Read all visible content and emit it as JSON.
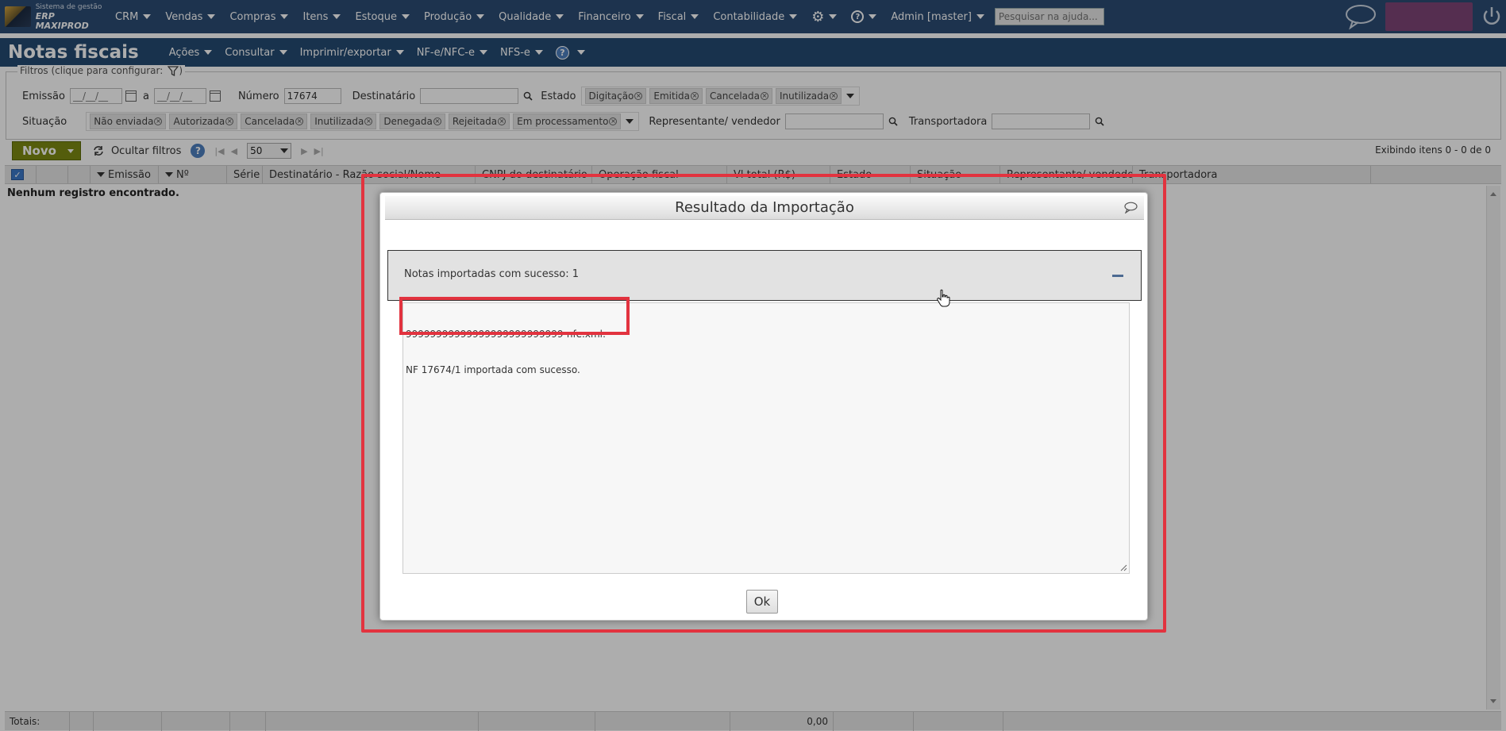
{
  "app": {
    "logo_small": "Sistema de gestão",
    "logo_big": "ERP MAXIPROD"
  },
  "topnav": {
    "items": [
      "CRM",
      "Vendas",
      "Compras",
      "Itens",
      "Estoque",
      "Produção",
      "Qualidade",
      "Financeiro",
      "Fiscal",
      "Contabilidade"
    ],
    "user": "Admin [master]",
    "search_placeholder": "Pesquisar na ajuda..."
  },
  "header": {
    "title": "Notas fiscais",
    "menu": [
      "Ações",
      "Consultar",
      "Imprimir/exportar",
      "NF-e/NFC-e",
      "NFS-e"
    ]
  },
  "filters": {
    "legend": "Filtros (clique para configurar:",
    "legend_close": ")",
    "emissao_label": "Emissão",
    "date_placeholder": "__/__/__",
    "a_label": "a",
    "numero_label": "Número",
    "numero_value": "17674",
    "destinatario_label": "Destinatário",
    "estado_label": "Estado",
    "estado_tags": [
      "Digitação",
      "Emitida",
      "Cancelada",
      "Inutilizada"
    ],
    "situacao_label": "Situação",
    "situacao_tags": [
      "Não enviada",
      "Autorizada",
      "Cancelada",
      "Inutilizada",
      "Denegada",
      "Rejeitada",
      "Em processamento"
    ],
    "representante_label": "Representante/ vendedor",
    "transportadora_label": "Transportadora"
  },
  "toolbar": {
    "novo_label": "Novo",
    "hide_filters": "Ocultar filtros",
    "page_size": "50",
    "count_text": "Exibindo itens 0 - 0 de 0"
  },
  "grid": {
    "columns": [
      "",
      "",
      "Emissão",
      "Nº",
      "Série",
      "Destinatário - Razão social/Nome",
      "CNPJ do destinatário",
      "Operação fiscal",
      "Vl total (R$)",
      "Estado",
      "Situação",
      "Representante/ vendedor",
      "Transportadora"
    ],
    "empty_message": "Nenhum registro encontrado.",
    "footer_label": "Totais:",
    "footer_total": "0,00"
  },
  "modal": {
    "title": "Resultado da Importação",
    "accordion_label": "Notas importadas com sucesso: 1",
    "result_line1": "99999999999999999999999999-nfe.xml:",
    "result_line2": "NF 17674/1 importada com sucesso.",
    "ok_label": "Ok"
  },
  "colors": {
    "topbar": "#2b4c74",
    "accent_green": "#7d8a12",
    "highlight_red": "#e2333f"
  }
}
